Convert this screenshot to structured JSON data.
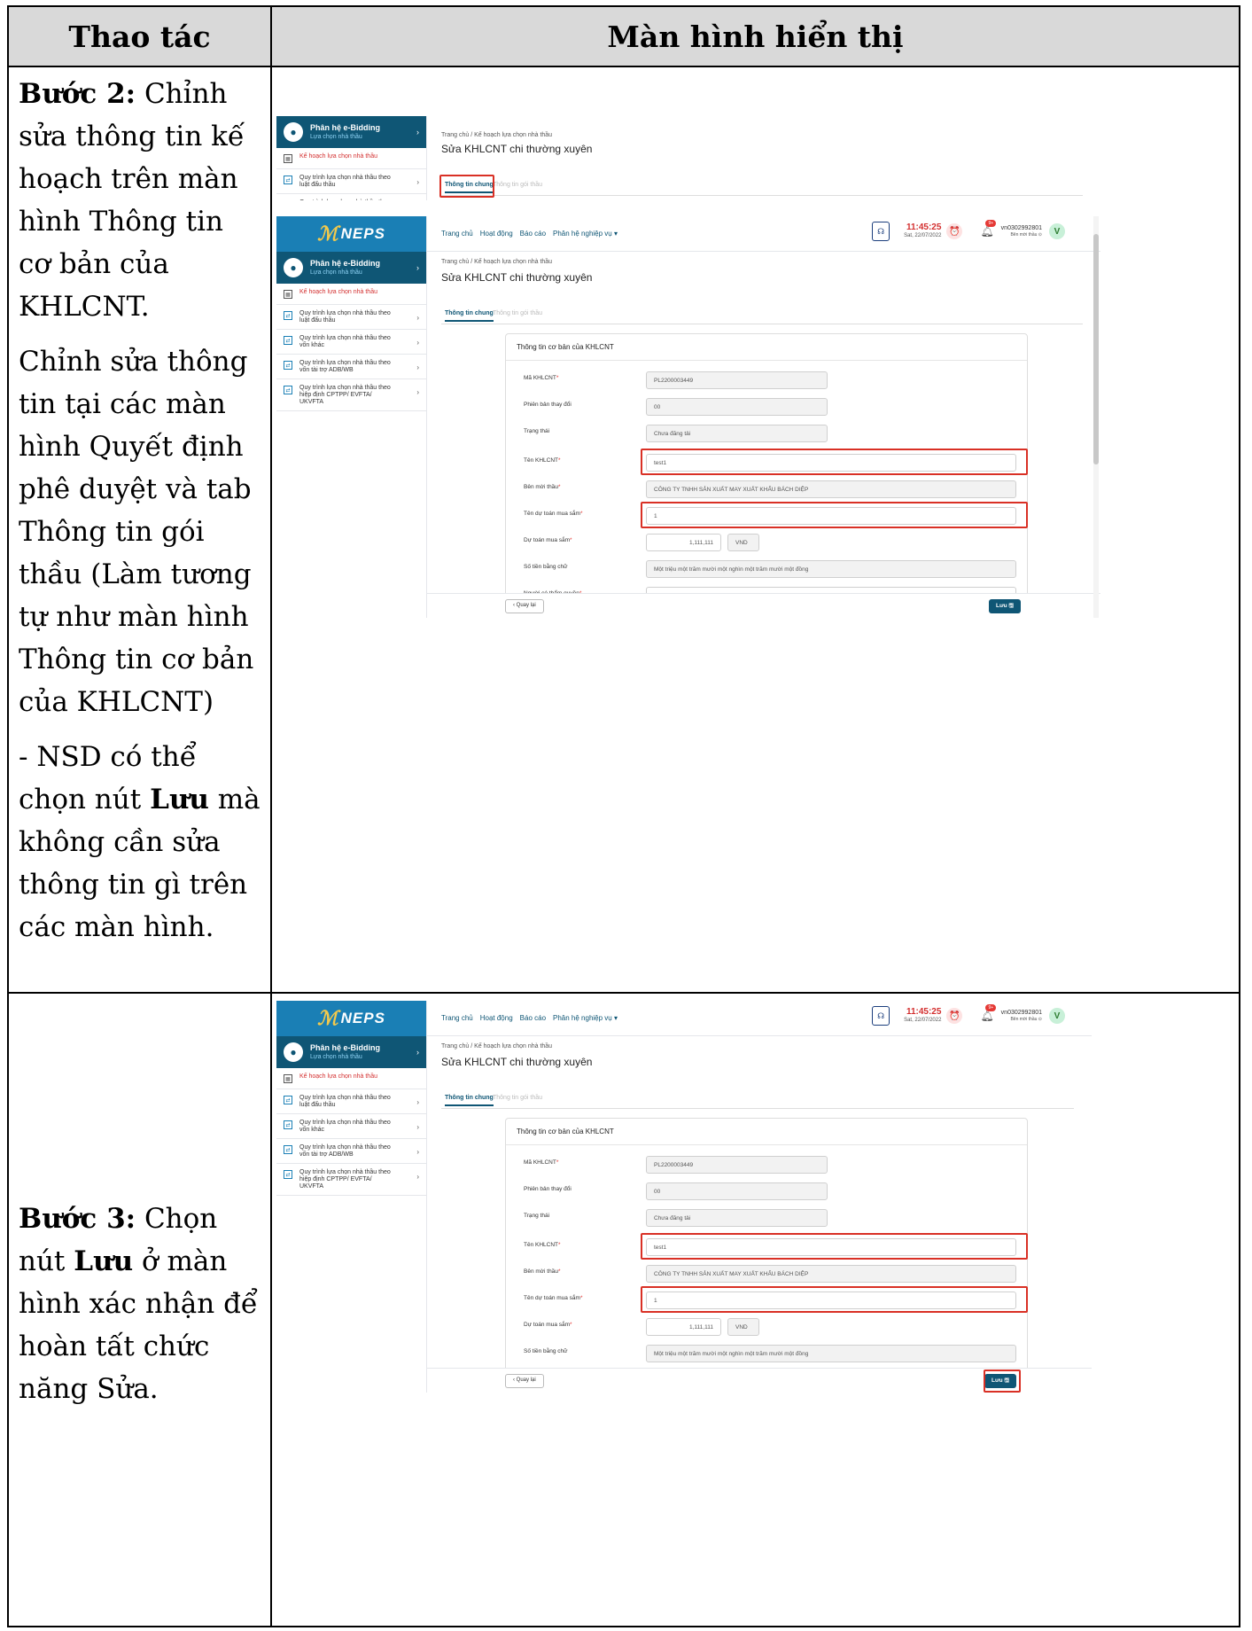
{
  "header": {
    "col_action": "Thao tác",
    "col_screen": "Màn hình hiển thị"
  },
  "step2": {
    "label": "Bước 2:",
    "text_a": " Chỉnh sửa thông tin kế hoạch trên màn hình Thông tin cơ bản của KHLCNT.",
    "para2": "Chỉnh sửa thông tin tại các màn hình Quyết định phê duyệt và tab Thông tin gói thầu (Làm tương tự như màn hình Thông tin cơ bản của KHLCNT)",
    "para3_pre": "- NSD có thể chọn nút ",
    "para3_bold": "Lưu",
    "para3_post": " mà không cần sửa thông tin gì trên các màn hình."
  },
  "step3": {
    "label": "Bước 3:",
    "text_a": " Chọn nút ",
    "text_bold": "Lưu",
    "text_b": " ở màn hình xác nhận để hoàn tất chức năng Sửa."
  },
  "ui": {
    "brand": "NEPS",
    "module_title": "Phân hệ e-Bidding",
    "module_sub": "Lựa chọn nhà thầu",
    "sidebar": [
      {
        "label": "Kế hoạch lựa chọn nhà thầu",
        "icon": "calendar-icon",
        "active": true
      },
      {
        "label": "Quy trình lựa chọn nhà thầu theo luật đấu thầu",
        "icon": "process-icon"
      },
      {
        "label": "Quy trình lựa chọn nhà thầu theo vốn khác",
        "icon": "process-icon"
      },
      {
        "label": "Quy trình lựa chọn nhà thầu theo vốn tài trợ ADB/WB",
        "icon": "process-icon"
      },
      {
        "label": "Quy trình lựa chọn nhà thầu theo hiệp định CPTPP/ EVFTA/ UKVFTA",
        "icon": "process-icon"
      }
    ],
    "nav": [
      "Trang chủ",
      "Hoạt động",
      "Báo cáo",
      "Phân hệ nghiệp vụ ▾"
    ],
    "clock_time": "11:45:25",
    "clock_date": "Sat, 22/07/2022",
    "badge": "9+",
    "user_name": "vn0302992801",
    "user_role": "Bên mời thầu ⊙",
    "avatar": "V",
    "breadcrumb": "Trang chủ  /  Kế hoạch lựa chọn nhà thầu",
    "page_title": "Sửa KHLCNT chi thường xuyên",
    "tab_general": "Thông tin chung",
    "tab_package": "Thông tin gói thầu",
    "card_title": "Thông tin cơ bản của KHLCNT",
    "fields": [
      {
        "label": "Mã KHLCNT",
        "req": "*",
        "value": "PL2200003449"
      },
      {
        "label": "Phiên bản thay đổi",
        "req": "",
        "value": "00"
      },
      {
        "label": "Trạng thái",
        "req": "",
        "value": "Chưa đăng tải"
      },
      {
        "label": "Tên KHLCNT",
        "req": "*",
        "value": "test1"
      },
      {
        "label": "Bên mời thầu",
        "req": "*",
        "value": "CÔNG TY TNHH SẢN XUẤT MAY XUẤT KHẨU BÁCH DIỆP"
      },
      {
        "label": "Tên dự toán mua sắm",
        "req": "*",
        "value": "1"
      },
      {
        "label": "Dự toán mua sắm",
        "req": "*",
        "value": "1,111,111"
      },
      {
        "label": "Số tiền bằng chữ",
        "req": "",
        "value": "Một triệu một trăm mười một nghìn một trăm mười một đồng"
      },
      {
        "label": "Người có thẩm quyền",
        "req": "*",
        "value": "...."
      }
    ],
    "currency": "VND",
    "back_label": "‹  Quay lại",
    "save_label": "Lưu 🖫"
  },
  "colors": {
    "accent": "#0f5675",
    "brand": "#1a7fb5",
    "highlight": "#d93025",
    "header_bg": "#d9d9d9"
  }
}
